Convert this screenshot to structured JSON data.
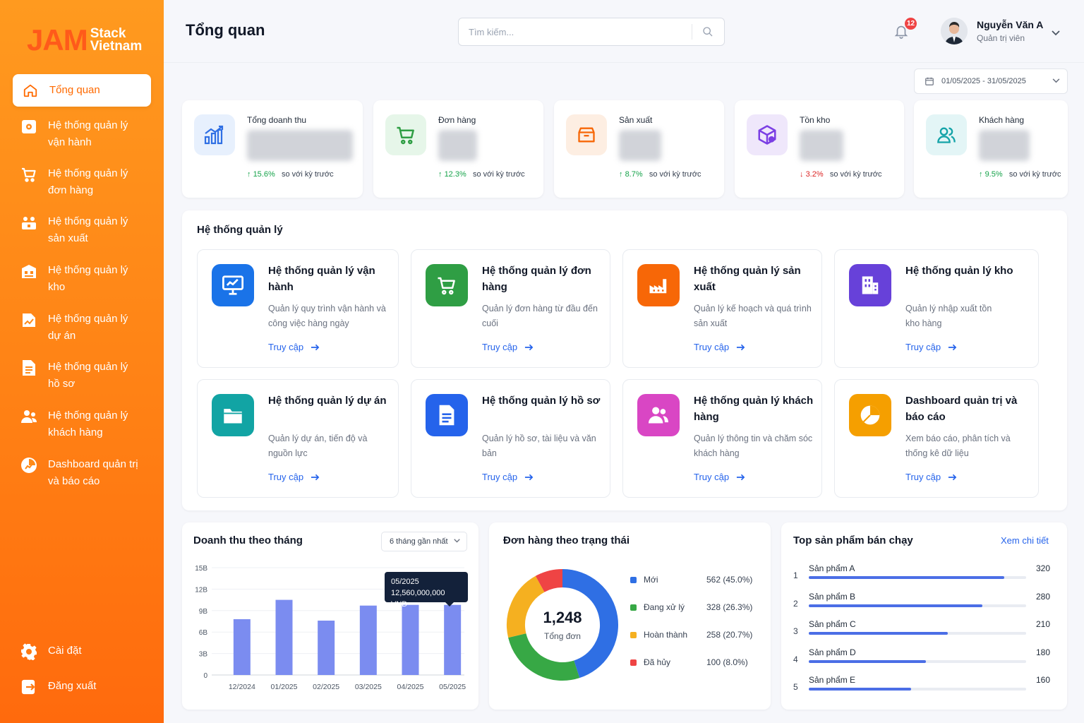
{
  "brand": {
    "logo_main": "JAM",
    "logo_line1": "Stack",
    "logo_line2": "Vietnam",
    "accent": "#ff7a12"
  },
  "sidebar": {
    "items": [
      {
        "label": "Tổng quan",
        "icon": "home-icon",
        "active": true
      },
      {
        "label": "Hệ thống quản lý vận hành",
        "icon": "operations-icon"
      },
      {
        "label": "Hệ thống quản lý đơn hàng",
        "icon": "cart-icon"
      },
      {
        "label": "Hệ thống quản lý sản xuất",
        "icon": "production-icon"
      },
      {
        "label": "Hệ thống quản lý kho",
        "icon": "warehouse-icon"
      },
      {
        "label": "Hệ thống quản lý dự án",
        "icon": "project-icon"
      },
      {
        "label": "Hệ thống quản lý hồ sơ",
        "icon": "document-icon"
      },
      {
        "label": "Hệ thống quản lý khách hàng",
        "icon": "customer-icon"
      },
      {
        "label": "Dashboard quản trị và báo cáo",
        "icon": "dashboard-icon"
      }
    ],
    "settings": "Cài đặt",
    "logout": "Đăng xuất"
  },
  "header": {
    "title": "Tổng quan",
    "search_placeholder": "Tìm kiếm...",
    "notification_count": "12",
    "user_name": "Nguyễn Văn A",
    "user_role": "Quản trị viên"
  },
  "date_range": "01/05/2025 - 31/05/2025",
  "kpis": [
    {
      "title": "Tổng doanh thu",
      "delta": "15.6%",
      "direction": "up",
      "compare": "so với kỳ trước",
      "icon": "chart-icon"
    },
    {
      "title": "Đơn hàng",
      "delta": "12.3%",
      "direction": "up",
      "compare": "so với kỳ trước",
      "icon": "cart-icon"
    },
    {
      "title": "Sản xuất",
      "delta": "8.7%",
      "direction": "up",
      "compare": "so với kỳ trước",
      "icon": "box-icon"
    },
    {
      "title": "Tồn kho",
      "delta": "3.2%",
      "direction": "down",
      "compare": "so với kỳ trước",
      "icon": "cube-icon"
    },
    {
      "title": "Khách hàng",
      "delta": "9.5%",
      "direction": "up",
      "compare": "so với kỳ trước",
      "icon": "users-icon"
    }
  ],
  "systems": {
    "title": "Hệ thống quản lý",
    "link_label": "Truy cập",
    "cards": [
      {
        "title": "Hệ thống quản lý vận hành",
        "desc": "Quản lý quy trình vận hành và công việc hàng ngày",
        "color": "#1a73e8",
        "icon": "monitor-icon"
      },
      {
        "title": "Hệ thống quản lý đơn hàng",
        "desc": "Quản lý đơn hàng từ đầu đến cuối",
        "color": "#2f9e44",
        "icon": "cart-icon"
      },
      {
        "title": "Hệ thống quản lý sản xuất",
        "desc": "Quản lý kế hoạch và quá trình sản xuất",
        "color": "#f76707",
        "icon": "factory-icon"
      },
      {
        "title": "Hệ thống quản lý kho",
        "desc": "Quản lý nhập xuất tồn kho hàng",
        "color": "#6741d9",
        "icon": "building-icon"
      },
      {
        "title": "Hệ thống quản lý dự án",
        "desc": "Quản lý dự án, tiến độ và nguồn lực",
        "color": "#12a4a4",
        "icon": "folder-icon"
      },
      {
        "title": "Hệ thống quản lý hồ sơ",
        "desc": "Quản lý hồ sơ, tài liệu và văn bản",
        "color": "#2563eb",
        "icon": "file-icon"
      },
      {
        "title": "Hệ thống quản lý khách hàng",
        "desc": "Quản lý thông tin và chăm sóc khách hàng",
        "color": "#d946c4",
        "icon": "users-icon"
      },
      {
        "title": "Dashboard quản trị và báo cáo",
        "desc": "Xem báo cáo, phân tích và thống kê dữ liệu",
        "color": "#f59f00",
        "icon": "pie-icon"
      }
    ]
  },
  "revenue": {
    "title": "Doanh thu theo tháng",
    "range_select": "6 tháng gần nhất",
    "tooltip_label": "05/2025",
    "tooltip_value": "12,560,000,000 VND"
  },
  "orders_status": {
    "title": "Đơn hàng theo trạng thái",
    "total": "1,248",
    "total_label": "Tổng đơn"
  },
  "top_products": {
    "title": "Top sản phẩm bán chạy",
    "see_more": "Xem chi tiết",
    "items": [
      {
        "rank": "1",
        "name": "Sản phẩm A",
        "value": "320",
        "share": 0.9
      },
      {
        "rank": "2",
        "name": "Sản phẩm B",
        "value": "280",
        "share": 0.8
      },
      {
        "rank": "3",
        "name": "Sản phẩm C",
        "value": "210",
        "share": 0.64
      },
      {
        "rank": "4",
        "name": "Sản phẩm D",
        "value": "180",
        "share": 0.54
      },
      {
        "rank": "5",
        "name": "Sản phẩm E",
        "value": "160",
        "share": 0.47
      }
    ]
  },
  "chart_data": [
    {
      "type": "bar",
      "title": "Doanh thu theo tháng",
      "categories": [
        "12/2024",
        "01/2025",
        "02/2025",
        "03/2025",
        "04/2025",
        "05/2025"
      ],
      "values": [
        7.8,
        10.5,
        7.6,
        9.7,
        9.8,
        9.8
      ],
      "y_ticks": [
        "0",
        "3B",
        "6B",
        "9B",
        "12B",
        "15B"
      ],
      "ylim": [
        0,
        15
      ],
      "bar_color": "#7b8cf0",
      "grid": true
    },
    {
      "type": "pie",
      "title": "Đơn hàng theo trạng thái",
      "series": [
        {
          "name": "Mới",
          "value": 562,
          "label": "562 (45.0%)",
          "color": "#2f6fe4"
        },
        {
          "name": "Đang xử lý",
          "value": 328,
          "label": "328 (26.3%)",
          "color": "#37a845"
        },
        {
          "name": "Hoàn thành",
          "value": 258,
          "label": "258 (20.7%)",
          "color": "#f5b020"
        },
        {
          "name": "Đã hủy",
          "value": 100,
          "label": "100 (8.0%)",
          "color": "#ef4444"
        }
      ]
    }
  ]
}
